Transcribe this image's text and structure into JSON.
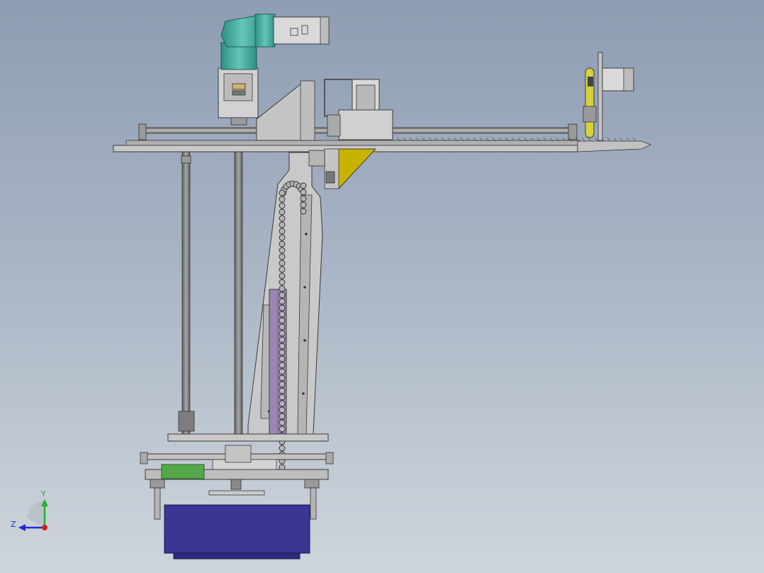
{
  "viewport": {
    "background_top": "#8e9db3",
    "background_bottom": "#cfd5dc"
  },
  "triad": {
    "y_label": "Y",
    "z_label": "Z",
    "y_color": "#1fb32a",
    "z_color": "#1f2bd1",
    "x_color": "#d11f1f"
  },
  "colors": {
    "frame": "#c9c9c9",
    "frame_dark": "#8f8f8f",
    "outline": "#3a3a3a",
    "motor_teal": "#4fb3a6",
    "motor_body": "#d9d9d9",
    "rod": "#8c8c8c",
    "gusset_yellow": "#c8b400",
    "belt_yellow": "#d6d13a",
    "plate_purple": "#9a86b3",
    "block_green": "#55a84a",
    "bin_blue": "#3b3593",
    "cable_chain": "#9a9a9a"
  }
}
